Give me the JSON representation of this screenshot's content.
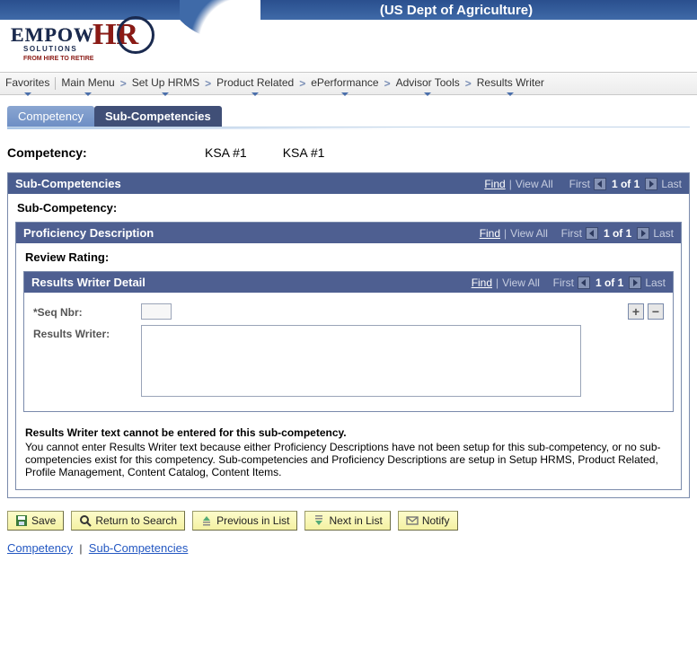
{
  "header": {
    "org_title": "(US Dept of Agriculture)",
    "logo": {
      "empow": "EMPOW",
      "hr": "HR",
      "sub1": "SOLUTIONS",
      "sub2": "FROM HIRE TO RETIRE"
    }
  },
  "breadcrumbs": {
    "favorites": "Favorites",
    "items": [
      "Main Menu",
      "Set Up HRMS",
      "Product Related",
      "ePerformance",
      "Advisor Tools",
      "Results Writer"
    ]
  },
  "tabs": {
    "competency": "Competency",
    "sub_competencies": "Sub-Competencies"
  },
  "competency": {
    "label": "Competency:",
    "code": "KSA #1",
    "desc": "KSA #1"
  },
  "subcomp_panel": {
    "title": "Sub-Competencies",
    "nav": {
      "find": "Find",
      "view_all": "View All",
      "first": "First",
      "counter": "1 of 1",
      "last": "Last"
    },
    "sub_label": "Sub-Competency:"
  },
  "prof_panel": {
    "title": "Proficiency Description",
    "nav": {
      "find": "Find",
      "view_all": "View All",
      "first": "First",
      "counter": "1 of 1",
      "last": "Last"
    },
    "review_label": "Review Rating:"
  },
  "detail_panel": {
    "title": "Results Writer Detail",
    "nav": {
      "find": "Find",
      "view_all": "View All",
      "first": "First",
      "counter": "1 of 1",
      "last": "Last"
    },
    "seq_label": "*Seq Nbr:",
    "seq_value": "",
    "rw_label": "Results Writer:",
    "rw_value": ""
  },
  "message": {
    "bold": "Results Writer text cannot be entered for this sub-competency.",
    "body": "You cannot enter Results Writer text because either Proficiency Descriptions have not been setup for this sub-competency, or no sub-competencies exist for this competency. Sub-competencies and Proficiency Descriptions are setup in Setup HRMS, Product Related, Profile Management, Content Catalog, Content Items."
  },
  "buttons": {
    "save": "Save",
    "return_to_search": "Return to Search",
    "prev_in_list": "Previous in List",
    "next_in_list": "Next in List",
    "notify": "Notify"
  },
  "bottom_links": {
    "competency": "Competency",
    "sub_competencies": "Sub-Competencies"
  },
  "icons": {
    "arrow_left": "arrow-left-icon",
    "arrow_right": "arrow-right-icon",
    "plus": "plus-icon",
    "minus": "minus-icon"
  },
  "colors": {
    "bluebar": "#4a5d8f",
    "accent": "#2458c2",
    "button": "#f4f1a2"
  }
}
